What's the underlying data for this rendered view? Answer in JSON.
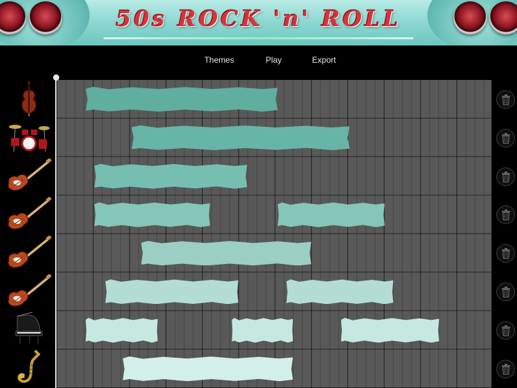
{
  "banner": {
    "title": "50s ROCK 'n' ROLL"
  },
  "menu": {
    "themes": "Themes",
    "play": "Play",
    "export": "Export"
  },
  "tracks": [
    {
      "instrument": "double-bass-icon",
      "blocks": [
        {
          "start": 0.07,
          "end": 0.51
        }
      ]
    },
    {
      "instrument": "drum-kit-icon",
      "blocks": [
        {
          "start": 0.175,
          "end": 0.675
        }
      ]
    },
    {
      "instrument": "electric-guitar-icon",
      "blocks": [
        {
          "start": 0.09,
          "end": 0.44
        }
      ]
    },
    {
      "instrument": "electric-guitar-icon",
      "blocks": [
        {
          "start": 0.09,
          "end": 0.355
        },
        {
          "start": 0.51,
          "end": 0.755
        }
      ]
    },
    {
      "instrument": "electric-guitar-icon",
      "blocks": [
        {
          "start": 0.197,
          "end": 0.587
        }
      ]
    },
    {
      "instrument": "electric-guitar-icon",
      "blocks": [
        {
          "start": 0.115,
          "end": 0.42
        },
        {
          "start": 0.53,
          "end": 0.775
        }
      ]
    },
    {
      "instrument": "grand-piano-icon",
      "blocks": [
        {
          "start": 0.07,
          "end": 0.235
        },
        {
          "start": 0.405,
          "end": 0.545
        },
        {
          "start": 0.655,
          "end": 0.88
        }
      ]
    },
    {
      "instrument": "saxophone-icon",
      "blocks": [
        {
          "start": 0.155,
          "end": 0.545
        }
      ]
    }
  ],
  "colors": {
    "accent_title": "#d9323a",
    "track_blocks": [
      "#5fae9e",
      "#67b5a6",
      "#76bfb0",
      "#85c6b8",
      "#9ccfc4",
      "#b3ddd4",
      "#c6e8e1",
      "#d2efea"
    ],
    "grid_background": "#595959"
  }
}
